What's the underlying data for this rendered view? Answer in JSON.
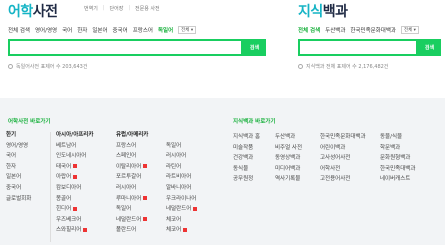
{
  "left_panel": {
    "brand_a": "어학",
    "brand_b": "사전",
    "top_nav": [
      "번역기",
      "단어장",
      "전문용 사전"
    ],
    "tabs": [
      "전체 검색",
      "영어/영영",
      "국어",
      "한자",
      "일본어",
      "중국어",
      "프랑스어",
      "독일어"
    ],
    "active_tab": "독일어",
    "dropdown_label": "전체",
    "search_button": "검색",
    "hint": "독일어사전 표제어 수 203,643건"
  },
  "right_panel": {
    "brand_a": "지식",
    "brand_b": "백과",
    "tabs": [
      "전체 검색",
      "두산백과",
      "한국민족문화대백과"
    ],
    "active_tab": "전체 검색",
    "dropdown_label": "전체",
    "search_button": "검색",
    "hint": "지식백과 전체 표제어 수 2,176,482건"
  },
  "dict_section": {
    "title": "어학사전 바로가기",
    "columns": [
      {
        "header": "한기",
        "items": [
          "영어/영영",
          "국어",
          "한자",
          "일본어",
          "중국어",
          "글로벌회화"
        ]
      },
      {
        "header": "아시아/아프리카",
        "items": [
          "베트남어",
          "인도네시아어",
          "태국어",
          "아랍어",
          "캄보디아어",
          "몽골어",
          "힌디어",
          "우즈베크어",
          "스와힐리어"
        ]
      },
      {
        "header": "유럽/아메리카",
        "items": [
          "프랑스어",
          "스페인어",
          "이탈리아어",
          "포르투갈어",
          "러시아어",
          "루마니아어",
          "독일어",
          "네덜란드어",
          "폴란드어"
        ]
      },
      {
        "header": "",
        "items": [
          "독일어",
          "러시아어",
          "라틴어",
          "라트비아어",
          "알바니아어",
          "우크라이나어",
          "네덜란드어",
          "체코어",
          "체코어"
        ]
      }
    ]
  },
  "encyc_section": {
    "title": "지식백과 바로가기",
    "columns": [
      {
        "items": [
          "지식백과 홈",
          "미술작품",
          "건강백과",
          "동식물",
          "공무원정"
        ]
      },
      {
        "items": [
          "두산백과",
          "비주얼 사전",
          "동영상백과",
          "미디어백과",
          "역사기록물"
        ]
      },
      {
        "items": [
          "한국민족문화대백과",
          "어린이백과",
          "고사성어사전",
          "어학사전",
          "고전용어사전"
        ]
      },
      {
        "items": [
          "동물/식물",
          "학문백과",
          "문화원형백과",
          "한국민족대백과",
          "네이버캐스트"
        ]
      }
    ]
  }
}
